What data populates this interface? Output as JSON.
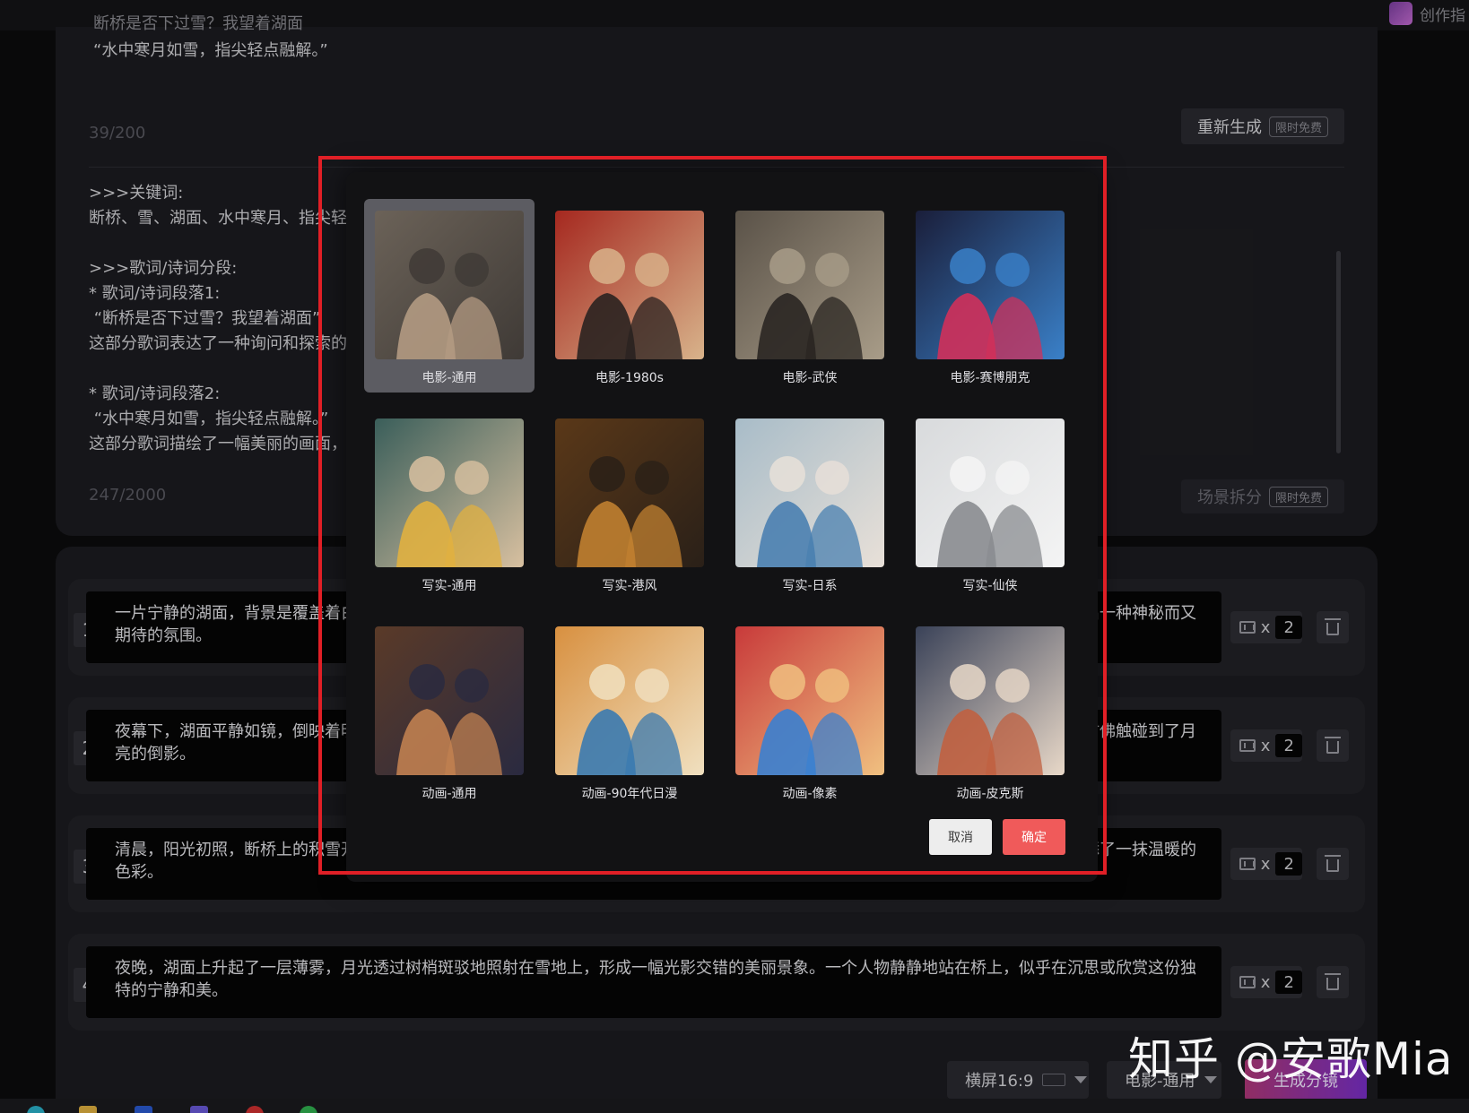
{
  "top_bar": {
    "right_label": "创作指"
  },
  "lyrics": {
    "line1": "断桥是否下过雪？我望着湖面",
    "line2": "“水中寒月如雪，指尖轻点融解。”",
    "char_count": "39/200",
    "regen_label": "重新生成",
    "free_tag": "限时免费"
  },
  "analysis": {
    "text": ">>>关键词:\n断桥、雪、湖面、水中寒月、指尖轻点\n\n>>>歌词/诗词分段:\n* 歌词/诗词段落1:\n “断桥是否下过雪？我望着湖面”\n这部分歌词表达了一种询问和探索的情绪\n\n* 歌词/诗词段落2:\n “水中寒月如雪，指尖轻点融解。”\n这部分歌词描绘了一幅美丽的画面，水中",
    "char_count": "247/2000",
    "scene_split_label": "场景拆分",
    "free_tag": "限时免费"
  },
  "scenes": [
    {
      "num": "1",
      "text": "一片宁静的湖面，背景是覆盖着白雪的断桥。阳光照耀下湖面闪烁着光芒，画面中，一个人影站在桥上，似乎在思考或是寻找什么，营造出一种神秘而又期待的氛围。",
      "x": "x",
      "count": "2"
    },
    {
      "num": "2",
      "text": "夜幕下，湖面平静如镜，倒映着明亮的月光，桥上覆盖着一层雪，一个人站在寒冷的湖边，伸出手指轻点湖面，激起一圈圈细小的涟漪，仿佛触碰到了月亮的倒影。",
      "x": "x",
      "count": "2"
    },
    {
      "num": "3",
      "text": "清晨，阳光初照，断桥上的积雪开始慢慢融化，滴落在静静的湖面上，发出轻微的声响。背景是远处轻薄的雾气和初升的太阳，给画面增添了一抹温暖的色彩。",
      "x": "x",
      "count": "2"
    },
    {
      "num": "4",
      "text": "夜晚，湖面上升起了一层薄雾，月光透过树梢斑驳地照射在雪地上，形成一幅光影交错的美丽景象。一个人物静静地站在桥上，似乎在沉思或欣赏这份独特的宁静和美。",
      "x": "x",
      "count": "2"
    }
  ],
  "bottom": {
    "ratio_label": "横屏16:9",
    "style_label": "电影-通用",
    "generate_label": "生成分镜"
  },
  "modal": {
    "styles": [
      {
        "label": "电影-通用",
        "selected": true,
        "palette": [
          "#6b6258",
          "#b39a82",
          "#3f3a36"
        ]
      },
      {
        "label": "电影-1980s",
        "selected": false,
        "palette": [
          "#a5281f",
          "#2a2220",
          "#d8b38b"
        ]
      },
      {
        "label": "电影-武侠",
        "selected": false,
        "palette": [
          "#5a5248",
          "#2a2622",
          "#a89c88"
        ]
      },
      {
        "label": "电影-赛博朋克",
        "selected": false,
        "palette": [
          "#1a1e3a",
          "#d0305a",
          "#3a80c8"
        ]
      },
      {
        "label": "写实-通用",
        "selected": false,
        "palette": [
          "#3a5e5a",
          "#e0b040",
          "#d8c0a0"
        ]
      },
      {
        "label": "写实-港风",
        "selected": false,
        "palette": [
          "#5a3818",
          "#c08030",
          "#2a2018"
        ]
      },
      {
        "label": "写实-日系",
        "selected": false,
        "palette": [
          "#a8bcc8",
          "#4a80b0",
          "#e8e0d8"
        ]
      },
      {
        "label": "写实-仙侠",
        "selected": false,
        "palette": [
          "#d8dadc",
          "#8a8c90",
          "#f4f4f4"
        ]
      },
      {
        "label": "动画-通用",
        "selected": false,
        "palette": [
          "#5a3a28",
          "#c08050",
          "#2a2a40"
        ]
      },
      {
        "label": "动画-90年代日漫",
        "selected": false,
        "palette": [
          "#d89040",
          "#3a7ab0",
          "#f0e0c0"
        ]
      },
      {
        "label": "动画-像素",
        "selected": false,
        "palette": [
          "#c83a3a",
          "#3a80d0",
          "#f0c080"
        ]
      },
      {
        "label": "动画-皮克斯",
        "selected": false,
        "palette": [
          "#3a4258",
          "#c06040",
          "#e8d8c8"
        ]
      }
    ],
    "cancel_label": "取消",
    "ok_label": "确定"
  },
  "watermark": "知乎 @安歌Mia",
  "colors": {
    "accent_red": "#f05a5a",
    "highlight_red": "#e01f26",
    "generate_gradient": [
      "#b0387a",
      "#7a2fc8"
    ]
  }
}
